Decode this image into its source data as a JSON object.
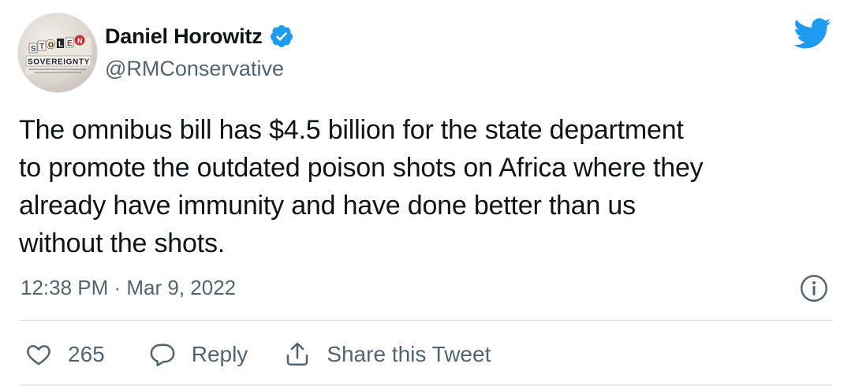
{
  "author": {
    "display_name": "Daniel Horowitz",
    "handle": "@RMConservative",
    "verified": true,
    "avatar_text": "STOLEN SOVEREIGNTY"
  },
  "tweet": {
    "text": "The omnibus bill has $4.5 billion for the state department\nto promote the outdated poison shots on Africa where they\nalready have immunity and have done better than us\nwithout the shots.",
    "timestamp": "12:38 PM · Mar 9, 2022"
  },
  "actions": {
    "like_count": "265",
    "reply_label": "Reply",
    "share_label": "Share this Tweet"
  },
  "colors": {
    "brand": "#1d9bf0",
    "secondary_text": "#536471",
    "primary_text": "#0f1419"
  },
  "icons": [
    "verified-badge-icon",
    "twitter-bird-icon",
    "info-icon",
    "heart-icon",
    "reply-bubble-icon",
    "share-icon"
  ]
}
